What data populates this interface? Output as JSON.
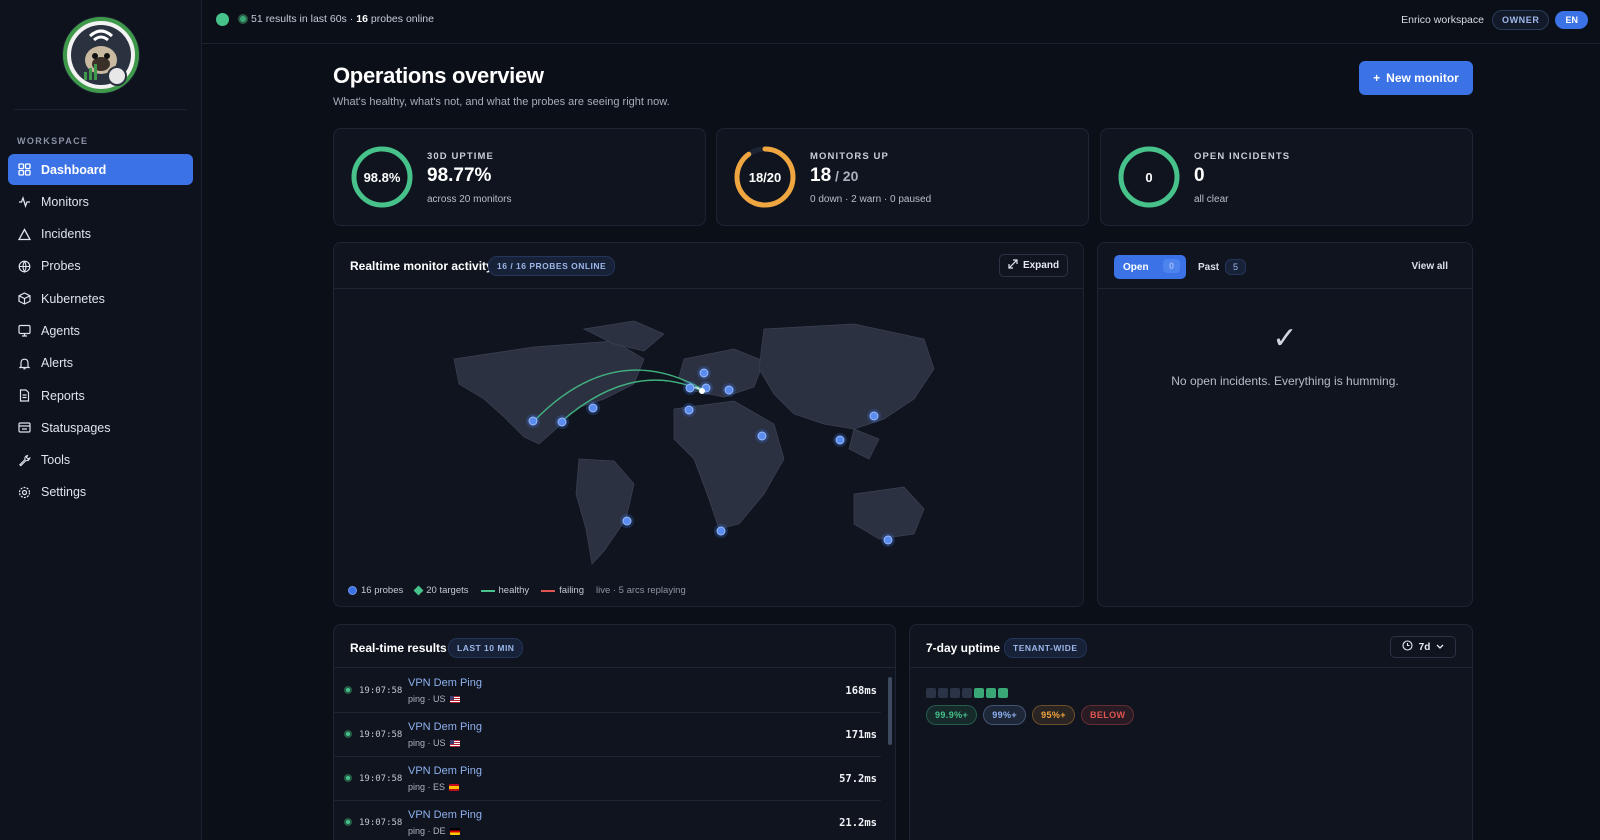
{
  "topbar": {
    "results_count": "51",
    "results_text": "results in last 60s ·",
    "probes_count": "16",
    "probes_text": "probes online",
    "workspace": "Enrico workspace",
    "role": "OWNER",
    "lang": "EN"
  },
  "sidebar": {
    "section": "WORKSPACE",
    "items": [
      {
        "label": "Dashboard",
        "icon": "grid-icon",
        "active": true
      },
      {
        "label": "Monitors",
        "icon": "pulse-icon"
      },
      {
        "label": "Incidents",
        "icon": "warning-triangle-icon"
      },
      {
        "label": "Probes",
        "icon": "globe-icon"
      },
      {
        "label": "Kubernetes",
        "icon": "cube-icon"
      },
      {
        "label": "Agents",
        "icon": "monitor-chat-icon"
      },
      {
        "label": "Alerts",
        "icon": "bell-icon"
      },
      {
        "label": "Reports",
        "icon": "document-icon"
      },
      {
        "label": "Statuspages",
        "icon": "statuspage-icon"
      },
      {
        "label": "Tools",
        "icon": "wrench-icon"
      },
      {
        "label": "Settings",
        "icon": "gear-icon"
      }
    ]
  },
  "page": {
    "title": "Operations overview",
    "subtitle": "What's healthy, what's not, and what the probes are seeing right now.",
    "new_monitor": "New monitor"
  },
  "stats": [
    {
      "ring": "98.8%",
      "title": "30D UPTIME",
      "value": "98.77%",
      "of": "",
      "sub": "across 20 monitors",
      "fraction": 0.988,
      "color": "#46c28a"
    },
    {
      "ring": "18/20",
      "title": "MONITORS UP",
      "value": "18",
      "of": " / 20",
      "sub": "0 down · 2 warn · 0 paused",
      "fraction": 0.9,
      "color": "#f0a640"
    },
    {
      "ring": "0",
      "title": "OPEN INCIDENTS",
      "value": "0",
      "of": "",
      "sub": "all clear",
      "fraction": 1.0,
      "color": "#46c28a"
    }
  ],
  "activity": {
    "title": "Realtime monitor activity",
    "badge": "16 / 16 PROBES ONLINE",
    "expand": "Expand",
    "legend": {
      "probes": "16 probes",
      "targets": "20 targets",
      "healthy": "healthy",
      "failing": "failing",
      "live": "live · 5 arcs replaying"
    },
    "colors": {
      "healthy": "#46c28a",
      "failing": "#e0554f",
      "probe": "#3b72e6"
    }
  },
  "incidents": {
    "tab_open": "Open",
    "open_count": "0",
    "tab_past": "Past",
    "past_count": "5",
    "view_all": "View all",
    "empty_icon": "checkmark-icon",
    "empty": "No open incidents. Everything is humming."
  },
  "results": {
    "title": "Real-time results",
    "badge": "LAST 10 MIN",
    "rows": [
      {
        "time": "19:07:58",
        "name": "VPN Dem Ping",
        "meta": "ping · US",
        "flag": "us",
        "ms": "168ms"
      },
      {
        "time": "19:07:58",
        "name": "VPN Dem Ping",
        "meta": "ping · US",
        "flag": "us",
        "ms": "171ms"
      },
      {
        "time": "19:07:58",
        "name": "VPN Dem Ping",
        "meta": "ping · ES",
        "flag": "es",
        "ms": "57.2ms"
      },
      {
        "time": "19:07:58",
        "name": "VPN Dem Ping",
        "meta": "ping · DE",
        "flag": "de",
        "ms": "21.2ms"
      }
    ]
  },
  "uptime": {
    "title": "7-day uptime",
    "badge": "TENANT-WIDE",
    "range": "7d",
    "legend": [
      {
        "label": "99.9%+",
        "color": "#46c28a"
      },
      {
        "label": "99%+",
        "color": "#8fb1f0"
      },
      {
        "label": "95%+",
        "color": "#f0a640"
      },
      {
        "label": "BELOW",
        "color": "#e0554f"
      }
    ]
  }
}
